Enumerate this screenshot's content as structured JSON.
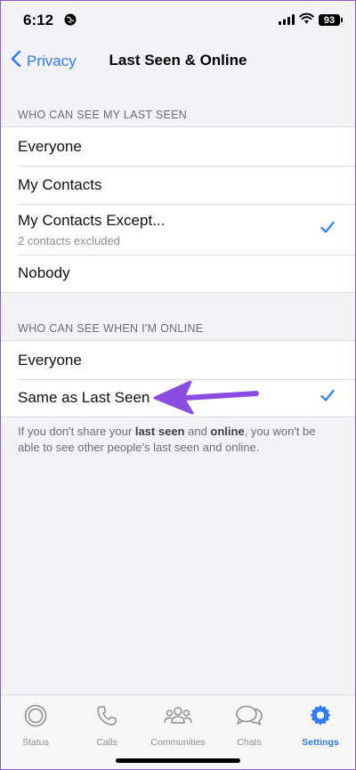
{
  "status_bar": {
    "time": "6:12",
    "battery": "93"
  },
  "nav": {
    "back_label": "Privacy",
    "title": "Last Seen & Online"
  },
  "last_seen": {
    "header": "WHO CAN SEE MY LAST SEEN",
    "options": [
      {
        "label": "Everyone"
      },
      {
        "label": "My Contacts"
      },
      {
        "label": "My Contacts Except...",
        "sublabel": "2 contacts excluded",
        "selected": true
      },
      {
        "label": "Nobody"
      }
    ]
  },
  "online": {
    "header": "WHO CAN SEE WHEN I'M ONLINE",
    "options": [
      {
        "label": "Everyone"
      },
      {
        "label": "Same as Last Seen",
        "selected": true
      }
    ],
    "note": {
      "part1": "If you don't share your ",
      "bold1": "last seen",
      "part2": " and ",
      "bold2": "online",
      "part3": ", you won't be able to see other people's last seen and online."
    }
  },
  "tabs": [
    {
      "label": "Status",
      "icon": "status-icon"
    },
    {
      "label": "Calls",
      "icon": "calls-icon"
    },
    {
      "label": "Communities",
      "icon": "communities-icon"
    },
    {
      "label": "Chats",
      "icon": "chats-icon"
    },
    {
      "label": "Settings",
      "icon": "settings-icon",
      "active": true
    }
  ],
  "colors": {
    "accent": "#2f7cf6",
    "annotation": "#8a4de0"
  }
}
